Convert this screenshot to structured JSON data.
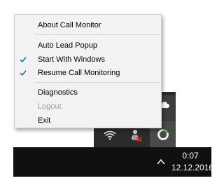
{
  "menu": {
    "items": [
      {
        "label": "About Call Monitor",
        "checked": false,
        "enabled": true
      },
      {
        "label": "Auto Lead Popup",
        "checked": false,
        "enabled": true
      },
      {
        "label": "Start With Windows",
        "checked": true,
        "enabled": true
      },
      {
        "label": "Resume Call Monitoring",
        "checked": true,
        "enabled": true
      },
      {
        "label": "Diagnostics",
        "checked": false,
        "enabled": true
      },
      {
        "label": "Logout",
        "checked": false,
        "enabled": false
      },
      {
        "label": "Exit",
        "checked": false,
        "enabled": true
      }
    ]
  },
  "tray": {
    "icons": [
      "wifi-icon",
      "call-monitor-app-icon",
      "power-status-icon",
      "cloud-icon"
    ]
  },
  "taskbar": {
    "time": "0:07",
    "date": "12.12.2016"
  },
  "colors": {
    "check": "#1f6fd1",
    "menu_bg": "#f2f2f2",
    "taskbar_bg": "#101010",
    "disabled_text": "#9d9d9d"
  }
}
